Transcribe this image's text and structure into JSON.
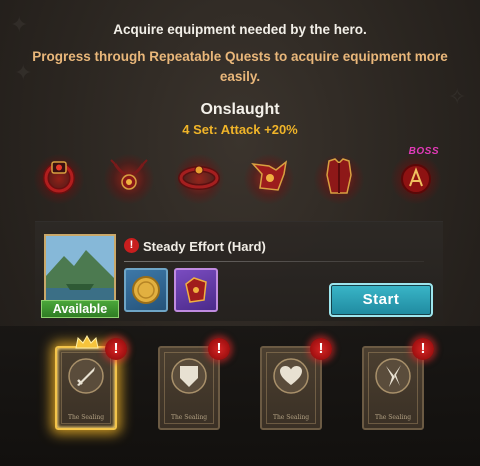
{
  "header": {
    "line1": "Acquire equipment needed by the hero.",
    "line2": "Progress through Repeatable Quests to acquire equipment more easily."
  },
  "equipment_set": {
    "name": "Onslaught",
    "bonus": "4 Set: Attack +20%",
    "items": [
      {
        "icon": "ring-icon"
      },
      {
        "icon": "necklace-icon"
      },
      {
        "icon": "bracelet-icon"
      },
      {
        "icon": "gauntlet-icon"
      },
      {
        "icon": "armor-icon"
      },
      {
        "icon": "boss-orb-icon",
        "tag": "BOSS"
      }
    ]
  },
  "quest": {
    "title": "Steady Effort (Hard)",
    "status": "Available",
    "warning": "!",
    "rewards": [
      {
        "icon": "gold-coin-icon"
      },
      {
        "icon": "gauntlet-reward-icon"
      }
    ],
    "start_label": "Start"
  },
  "cards": [
    {
      "emblem": "sword-icon",
      "selected": true,
      "alert": "!",
      "caption": "The Sealing"
    },
    {
      "emblem": "shield-icon",
      "selected": false,
      "alert": "!",
      "caption": "The Sealing"
    },
    {
      "emblem": "heart-icon",
      "selected": false,
      "alert": "!",
      "caption": "The Sealing"
    },
    {
      "emblem": "blades-icon",
      "selected": false,
      "alert": "!",
      "caption": "The Sealing"
    }
  ],
  "colors": {
    "accent_orange": "#e9b77a",
    "set_bonus": "#f0b429",
    "available_green": "#3a942f",
    "start_cyan": "#2a9fb4",
    "boss_pink": "#e43ab8",
    "alert_red": "#c81e1e"
  }
}
